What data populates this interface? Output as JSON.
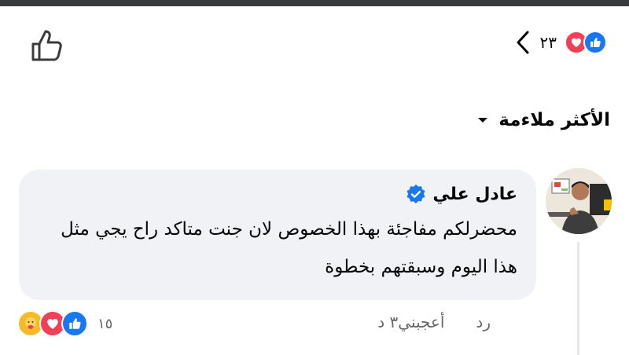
{
  "header": {
    "reaction_count": "٢٣",
    "reactions": [
      "like-icon",
      "love-icon"
    ]
  },
  "sort": {
    "label": "الأكثر ملاءمة"
  },
  "comment": {
    "author": "عادل علي",
    "text": "محضرلكم مفاجئة بهذا الخصوص لان جنت متاكد راح يجي مثل هذا اليوم وسبقتهم بخطوة",
    "time": "٣ د",
    "like_label": "أعجبني",
    "reply_label": "رد",
    "reaction_count": "١٥",
    "reactions": [
      "care-icon",
      "love-icon",
      "like-icon"
    ]
  },
  "colors": {
    "like_blue": "#1877f2",
    "love_red": "#f33e58",
    "care_yellow": "#f7b928",
    "bubble_bg": "#f0f2f5",
    "secondary_text": "#65676b"
  }
}
